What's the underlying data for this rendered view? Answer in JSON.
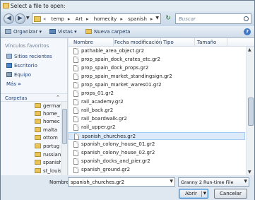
{
  "window": {
    "title": "Select a file to open:"
  },
  "address": {
    "breadcrumbs": [
      "temp",
      "Art",
      "homecity",
      "spanish"
    ],
    "search_placeholder": "Buscar"
  },
  "toolbar": {
    "organize": "Organizar",
    "views": "Vistas",
    "new_folder": "Nueva carpeta"
  },
  "sidebar": {
    "favorites_header": "Vínculos favoritos",
    "favorites": [
      "Sitios recientes",
      "Escritorio",
      "Equipo"
    ],
    "more": "Más",
    "folders_header": "Carpetas",
    "folders": [
      "germar",
      "home_",
      "homec",
      "malta",
      "ottom",
      "portug",
      "russian",
      "spanish",
      "st_louis"
    ]
  },
  "columns": [
    "Nombre",
    "Fecha modificación",
    "Tipo",
    "Tamaño"
  ],
  "files": [
    "pathable_area_object.gr2",
    "prop_spain_dock_crates_etc.gr2",
    "prop_spain_dock_props.gr2",
    "prop_spain_market_standingsign.gr2",
    "prop_spain_market_wares01.gr2",
    "props_01.gr2",
    "rail_academy.gr2",
    "rail_back.gr2",
    "rail_boardwalk.gr2",
    "rail_upper.gr2",
    "spanish_churches.gr2",
    "spanish_colony_house_01.gr2",
    "spanish_colony_house_02.gr2",
    "spanish_docks_and_pier.gr2",
    "spanish_ground.gr2"
  ],
  "selected_file": "spanish_churches.gr2",
  "footer": {
    "filename_label": "Nombre:",
    "filename_value": "spanish_churches.gr2",
    "filetype": "Granny 2 Run-time File",
    "open_button": "Abrir",
    "cancel_button": "Cancelar"
  },
  "colors": {
    "selection": "#dcebfc",
    "link": "#1c3f7a",
    "folder": "#e8c45a"
  }
}
